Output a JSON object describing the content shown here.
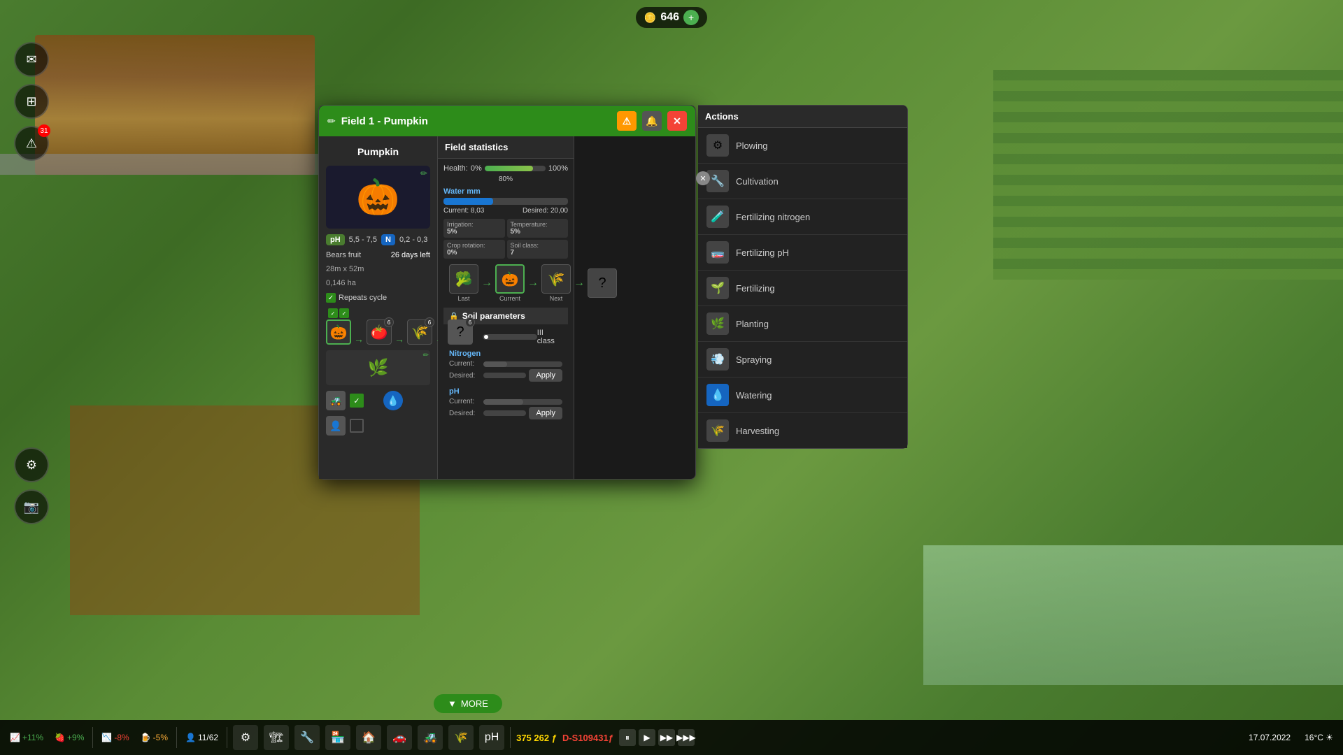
{
  "hud": {
    "coin_count": "646",
    "add_label": "+",
    "date": "17.07.2022",
    "time": "16°C ☀",
    "money": "375 262 ƒ",
    "balance": "D-S109431ƒ",
    "stat1": "+11%",
    "stat2": "+9%",
    "stat3": "-8%",
    "stat4": "-5%",
    "stat5": "11/62",
    "pause_label": "⏸",
    "play_label": "▶",
    "ff1_label": "▶▶",
    "ff2_label": "▶▶▶"
  },
  "dialog": {
    "title": "Field 1 - Pumpkin",
    "left_panel": {
      "heading": "Pumpkin",
      "ph_label": "pH",
      "ph_value": "5,5 - 7,5",
      "n_label": "N",
      "n_value": "0,2 - 0,3",
      "bears_fruit": "Bears fruit",
      "days_left": "26 days left",
      "field_size": "28m x 52m",
      "field_area": "0,146 ha",
      "repeats_cycle": "Repeats cycle",
      "crop_last": "Last",
      "crop_current": "Current",
      "crop_next": "Next"
    },
    "middle_panel": {
      "heading": "Field statistics",
      "health_label": "Health:",
      "health_pct_left": "0%",
      "health_pct_right": "100%",
      "health_pct_center": "80%",
      "water_mm": "Water mm",
      "water_current": "Current: 8,03",
      "water_desired": "Desired: 20,00",
      "irrigation_label": "Irrigation:",
      "irrigation_value": "5%",
      "temperature_label": "Temperature:",
      "temperature_value": "5%",
      "crop_rotation_label": "Crop rotation:",
      "crop_rotation_value": "0%",
      "soil_class_label": "Soil class:",
      "soil_class_value": "7",
      "soil_header": "Soil parameters",
      "soil_class_row_label": "Soil class:",
      "soil_class_row_bar": "",
      "soil_class_row_value": "III class",
      "nitrogen_label": "Nitrogen",
      "nitrogen_current": "Current:",
      "nitrogen_desired": "Desired:",
      "ph_param_label": "pH",
      "ph_current": "Current:",
      "ph_desired": "Desired:",
      "apply1_label": "Apply",
      "apply2_label": "Apply"
    },
    "actions_panel": {
      "heading": "Actions",
      "plowing": "Plowing",
      "cultivation": "Cultivation",
      "fertilizing_nitrogen": "Fertilizing nitrogen",
      "fertilizing_ph": "Fertilizing pH",
      "fertilizing": "Fertilizing",
      "planting": "Planting",
      "spraying": "Spraying",
      "watering": "Watering",
      "harvesting": "Harvesting"
    }
  },
  "more_btn": "MORE",
  "sidebar": {
    "mail_icon": "✉",
    "layers_icon": "⊞",
    "alert_icon": "⚠",
    "alert_badge": "31",
    "settings_icon": "⚙",
    "camera_icon": "📷"
  }
}
